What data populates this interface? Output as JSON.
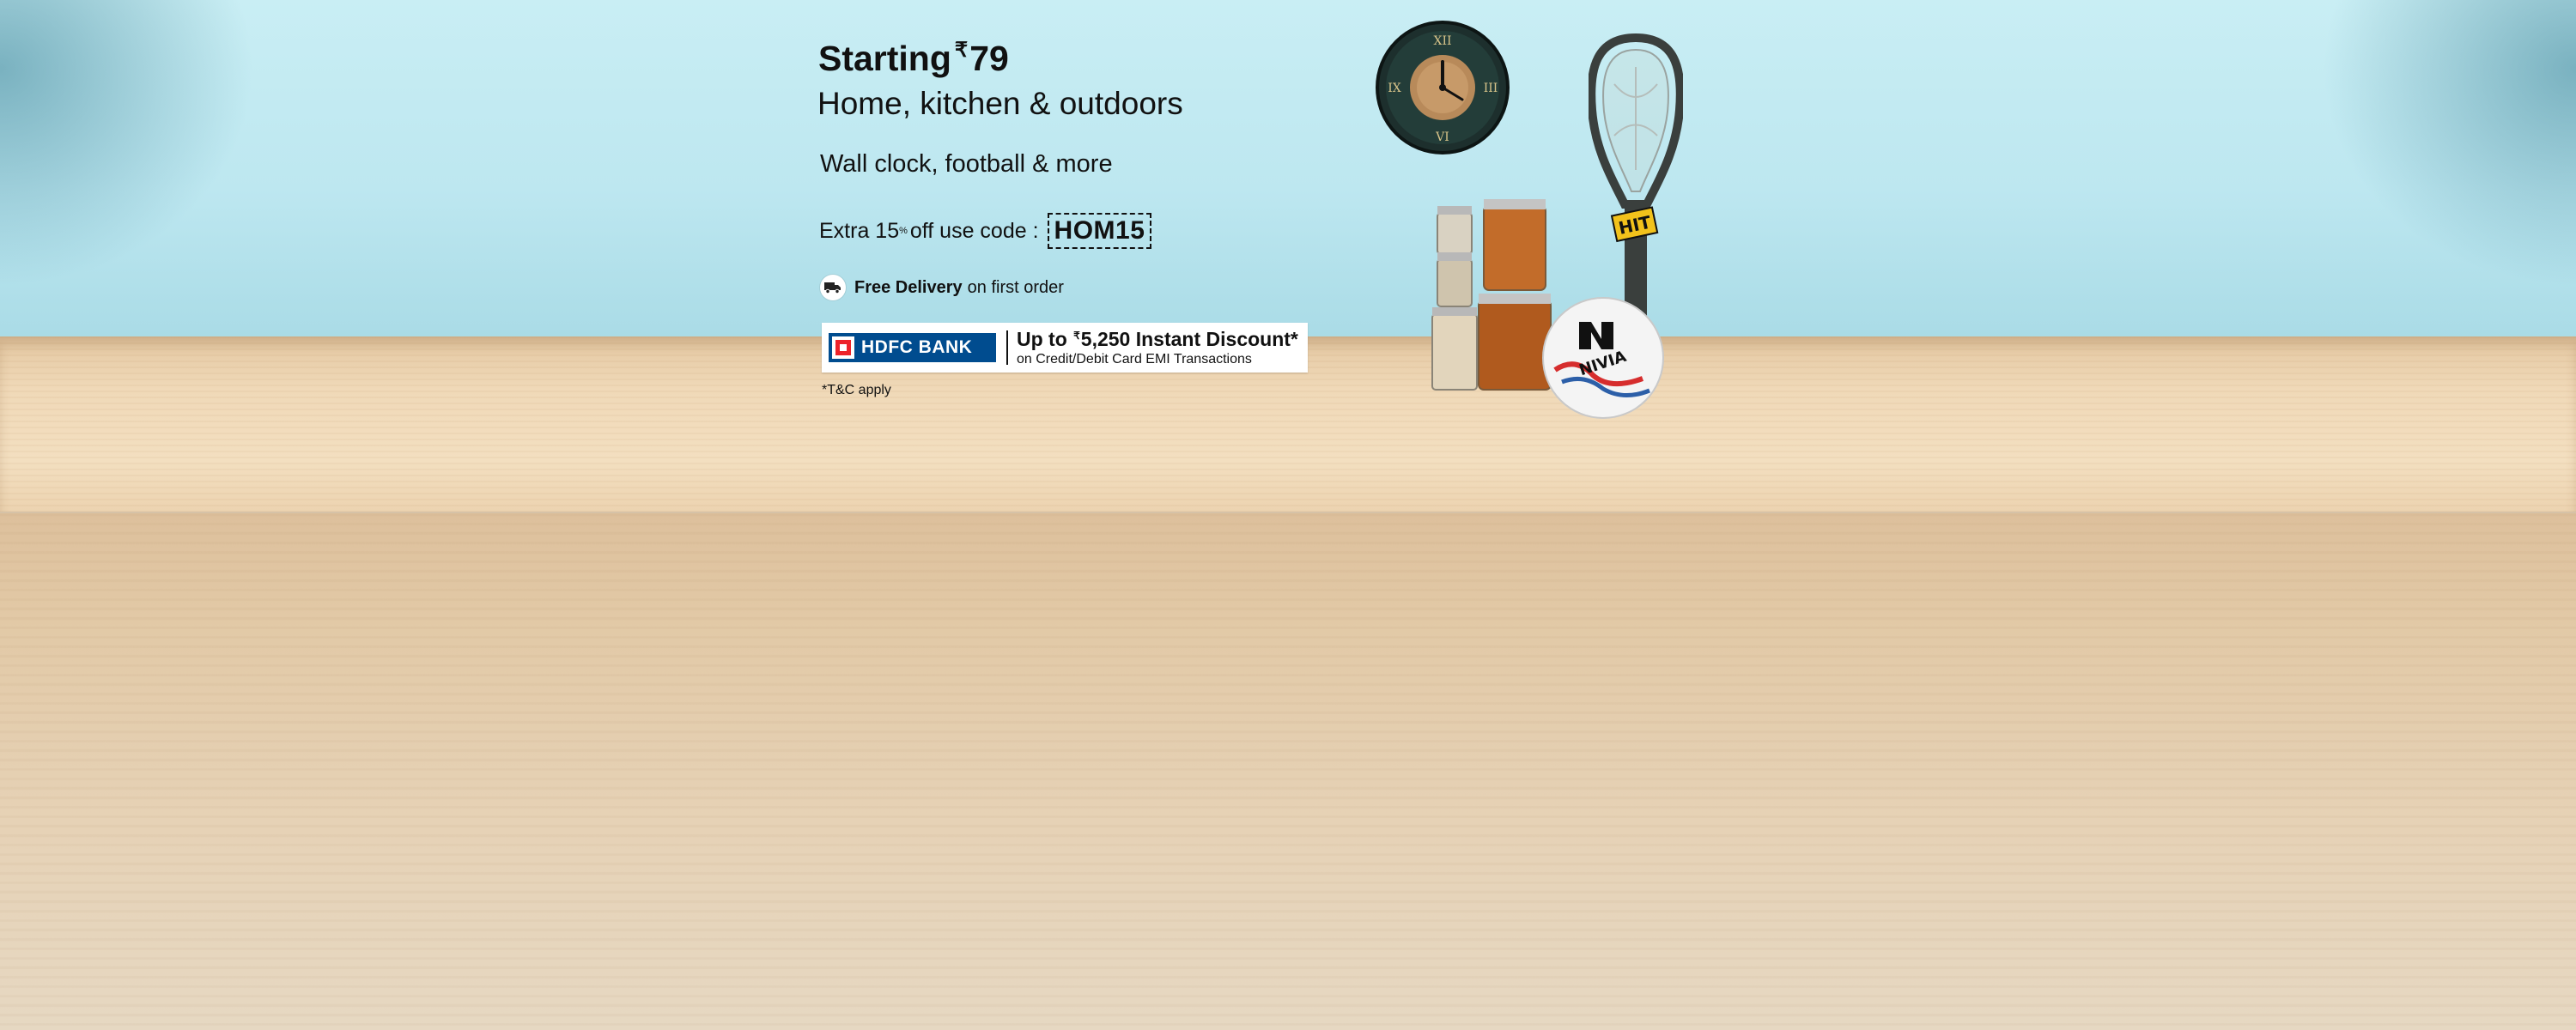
{
  "banner": {
    "headline_prefix": "Starting",
    "currency_symbol": "₹",
    "starting_price": "79",
    "subheadline": "Home, kitchen & outdoors",
    "tagline": "Wall clock, football & more"
  },
  "offer": {
    "text_before": "Extra 15",
    "percent_sign": "%",
    "text_after": "off use code :",
    "coupon_code": "HOM15"
  },
  "delivery": {
    "icon": "truck-icon",
    "bold_text": "Free Delivery",
    "rest_text": "on first order"
  },
  "bank_offer": {
    "bank_name": "HDFC BANK",
    "headline_before": "Up to",
    "currency_symbol": "₹",
    "headline_after": "5,250 Instant Discount*",
    "subline": "on Credit/Debit Card EMI Transactions"
  },
  "terms": "*T&C apply",
  "products": {
    "clock_roman_numerals": [
      "XII",
      "III",
      "VI",
      "IX"
    ],
    "racket_brand": "HIT",
    "ball_brand": "NIVIA"
  },
  "colors": {
    "wall": "#bde7f0",
    "table": "#f0d9b8",
    "bank_blue": "#004c8f",
    "bank_red": "#ed232a"
  }
}
